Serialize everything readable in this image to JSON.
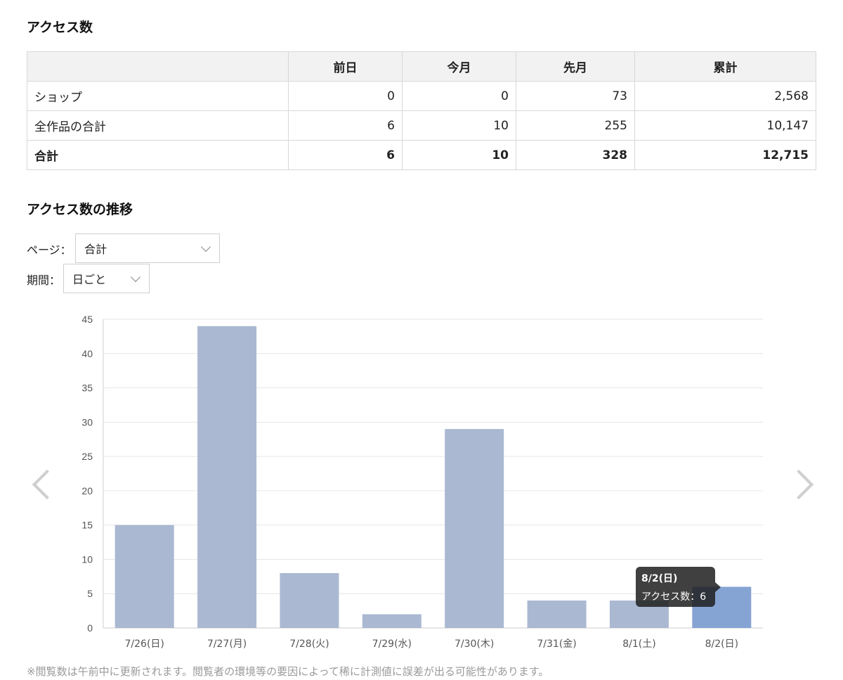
{
  "access_section": {
    "title": "アクセス数",
    "columns": [
      "",
      "前日",
      "今月",
      "先月",
      "累計"
    ],
    "rows": [
      {
        "label": "ショップ",
        "values": [
          "0",
          "0",
          "73",
          "2,568"
        ]
      },
      {
        "label": "全作品の合計",
        "values": [
          "6",
          "10",
          "255",
          "10,147"
        ]
      },
      {
        "label": "合計",
        "values": [
          "6",
          "10",
          "328",
          "12,715"
        ]
      }
    ]
  },
  "trend_section": {
    "title": "アクセス数の推移",
    "page_label": "ページ：",
    "page_value": "合計",
    "period_label": "期間：",
    "period_value": "日ごと"
  },
  "tooltip": {
    "title": "8/2(日)",
    "body": "アクセス数：6"
  },
  "note": "※閲覧数は午前中に更新されます。閲覧者の環境等の要因によって稀に計測値に誤差が出る可能性があります。",
  "colors": {
    "bar": "#aab8d1",
    "bar_highlight": "#86a4d3",
    "grid": "#e6e6e6",
    "axis_text": "#555555"
  },
  "icons": {
    "prev": "chevron-left-icon",
    "next": "chevron-right-icon",
    "dropdown": "chevron-down-icon"
  },
  "chart_data": {
    "type": "bar",
    "categories": [
      "7/26(日)",
      "7/27(月)",
      "7/28(火)",
      "7/29(水)",
      "7/30(木)",
      "7/31(金)",
      "8/1(土)",
      "8/2(日)"
    ],
    "values": [
      15,
      44,
      8,
      2,
      29,
      4,
      4,
      6
    ],
    "ylim": [
      0,
      45
    ],
    "yticks": [
      0,
      5,
      10,
      15,
      20,
      25,
      30,
      35,
      40,
      45
    ],
    "highlight_index": 7,
    "grid": true,
    "xlabel": "",
    "ylabel": ""
  }
}
